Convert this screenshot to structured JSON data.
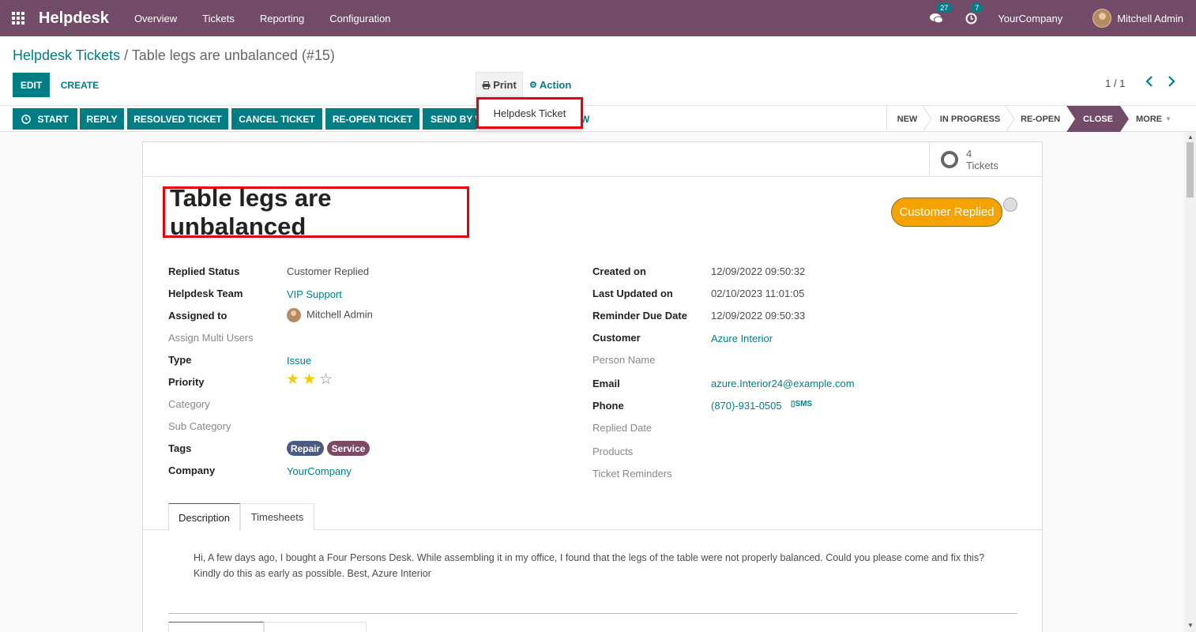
{
  "navbar": {
    "brand": "Helpdesk",
    "menu": [
      "Overview",
      "Tickets",
      "Reporting",
      "Configuration"
    ],
    "messages_count": "27",
    "activities_count": "7",
    "company": "YourCompany",
    "user": "Mitchell Admin"
  },
  "control_panel": {
    "breadcrumb_parent": "Helpdesk Tickets",
    "breadcrumb_separator": " / ",
    "breadcrumb_current": "Table legs are unbalanced (#15)",
    "edit_label": "EDIT",
    "create_label": "CREATE",
    "print_label": "Print",
    "action_label": "Action",
    "pager_value": "1 / 1"
  },
  "print_menu": {
    "items": [
      "Helpdesk Ticket"
    ]
  },
  "statusbar": {
    "buttons": [
      "START",
      "REPLY",
      "RESOLVED TICKET",
      "CANCEL TICKET",
      "RE-OPEN TICKET",
      "SEND BY W",
      "W"
    ],
    "stages": [
      "NEW",
      "IN PROGRESS",
      "RE-OPEN",
      "CLOSE",
      "MORE"
    ],
    "active_stage": "CLOSE"
  },
  "smart_button": {
    "count": "4",
    "label": "Tickets"
  },
  "ticket": {
    "title": "Table legs are unbalanced",
    "ribbon": "Customer Replied",
    "left_fields": [
      {
        "label": "Replied Status",
        "value": "Customer Replied"
      },
      {
        "label": "Helpdesk Team",
        "value": "VIP Support"
      },
      {
        "label": "Assigned to",
        "value": "Mitchell Admin"
      },
      {
        "label": "Assign Multi Users",
        "value": ""
      },
      {
        "label": "Type",
        "value": "Issue"
      },
      {
        "label": "Priority",
        "value": ""
      },
      {
        "label": "Category",
        "value": ""
      },
      {
        "label": "Sub Category",
        "value": ""
      },
      {
        "label": "Tags",
        "value": ""
      },
      {
        "label": "Company",
        "value": "YourCompany"
      }
    ],
    "priority_stars": 2,
    "priority_max": 3,
    "tags": [
      "Repair",
      "Service"
    ],
    "right_fields": [
      {
        "label": "Created on",
        "value": "12/09/2022 09:50:32"
      },
      {
        "label": "Last Updated on",
        "value": "02/10/2023 11:01:05"
      },
      {
        "label": "Reminder Due Date",
        "value": "12/09/2022 09:50:33"
      },
      {
        "label": "Customer",
        "value": "Azure Interior"
      },
      {
        "label": "Person Name",
        "value": ""
      },
      {
        "label": "Email",
        "value": "azure.Interior24@example.com"
      },
      {
        "label": "Phone",
        "value": "(870)-931-0505"
      },
      {
        "label": "Replied Date",
        "value": ""
      },
      {
        "label": "Products",
        "value": ""
      },
      {
        "label": "Ticket Reminders",
        "value": ""
      }
    ],
    "sms_label": "SMS"
  },
  "tabs": {
    "description": "Description",
    "timesheets": "Timesheets"
  },
  "description_text": "Hi, A few days ago, I bought a Four Persons Desk. While assembling it in my office, I found that the legs of the table were not properly balanced. Could you please come and fix this? Kindly do this as early as possible. Best, Azure Interior",
  "colors": {
    "brand": "#714b67",
    "primary": "#017e84",
    "ribbon": "#f5a300",
    "highlight": "#e3000f",
    "tag_repair": "#4a5a80",
    "tag_service": "#7d4a66"
  }
}
